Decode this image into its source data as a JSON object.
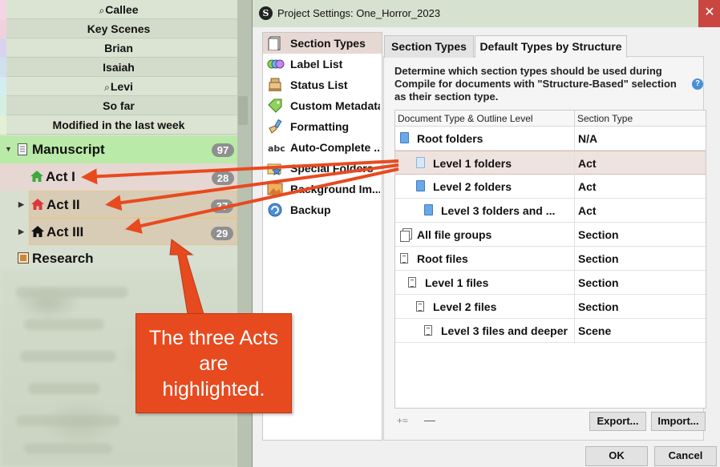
{
  "binder": {
    "collections": [
      {
        "label": "Callee",
        "search": true,
        "strip": "#f3d6e3"
      },
      {
        "label": "Key Scenes",
        "search": false,
        "strip": "#f1d1de"
      },
      {
        "label": "Brian",
        "search": false,
        "strip": "#d9d3ef"
      },
      {
        "label": "Isaiah",
        "search": false,
        "strip": "#cfe0ef"
      },
      {
        "label": "Levi",
        "search": true,
        "strip": "#d3eeee"
      },
      {
        "label": "So far",
        "search": false,
        "strip": "#d6efe2"
      },
      {
        "label": "Modified in the last week",
        "search": false,
        "strip": "#e3f0d6"
      }
    ],
    "manuscript": {
      "label": "Manuscript",
      "count": "97"
    },
    "acts": [
      {
        "label": "Act I",
        "count": "28",
        "icon_color": "#3fa83f"
      },
      {
        "label": "Act II",
        "count": "37",
        "icon_color": "#d93a3a"
      },
      {
        "label": "Act III",
        "count": "29",
        "icon_color": "#111111"
      }
    ],
    "research": {
      "label": "Research"
    }
  },
  "callout": {
    "lines": [
      "The three Acts",
      "are",
      "highlighted."
    ],
    "color": "#e84a1f"
  },
  "dialog": {
    "title": "Project Settings: One_Horror_2023",
    "app_icon_letter": "S",
    "close_glyph": "✕",
    "sidebar": [
      {
        "label": "Section Types",
        "icon": "section-types-icon",
        "selected": true
      },
      {
        "label": "Label List",
        "icon": "label-list-icon",
        "selected": false
      },
      {
        "label": "Status List",
        "icon": "status-list-icon",
        "selected": false
      },
      {
        "label": "Custom Metadata",
        "icon": "custom-metadata-icon",
        "selected": false
      },
      {
        "label": "Formatting",
        "icon": "formatting-icon",
        "selected": false
      },
      {
        "label": "Auto-Complete ...",
        "icon": "abc-icon",
        "selected": false
      },
      {
        "label": "Special Folders",
        "icon": "special-folders-icon",
        "selected": false
      },
      {
        "label": "Background Im...",
        "icon": "background-image-icon",
        "selected": false
      },
      {
        "label": "Backup",
        "icon": "backup-icon",
        "selected": false
      }
    ],
    "tabs": [
      {
        "label": "Section Types",
        "active": false
      },
      {
        "label": "Default Types by Structure",
        "active": true
      }
    ],
    "description": "Determine which section types should be used during Compile for documents with \"Structure-Based\" selection as their section type.",
    "help_glyph": "?",
    "table": {
      "headers": [
        "Document Type & Outline Level",
        "Section Type"
      ],
      "rows": [
        {
          "name": "Root folders",
          "type": "N/A",
          "icon": "folder",
          "indent": 0,
          "selected": false
        },
        {
          "name": "Level 1 folders",
          "type": "Act",
          "icon": "folder-light",
          "indent": 1,
          "selected": true
        },
        {
          "name": "Level 2 folders",
          "type": "Act",
          "icon": "folder",
          "indent": 2,
          "selected": false
        },
        {
          "name": "Level 3 folders and ...",
          "type": "Act",
          "icon": "folder",
          "indent": 3,
          "selected": false
        },
        {
          "name": "All file groups",
          "type": "Section",
          "icon": "group",
          "indent": 0,
          "selected": false
        },
        {
          "name": "Root files",
          "type": "Section",
          "icon": "file",
          "indent": 0,
          "selected": false
        },
        {
          "name": "Level 1 files",
          "type": "Section",
          "icon": "file",
          "indent": 1,
          "selected": false
        },
        {
          "name": "Level 2 files",
          "type": "Section",
          "icon": "file",
          "indent": 2,
          "selected": false
        },
        {
          "name": "Level 3 files and deeper",
          "type": "Scene",
          "icon": "file",
          "indent": 3,
          "selected": false
        }
      ]
    },
    "add_label": "+≈",
    "remove_label": "—",
    "export_label": "Export...",
    "import_label": "Import...",
    "ok_label": "OK",
    "cancel_label": "Cancel"
  }
}
